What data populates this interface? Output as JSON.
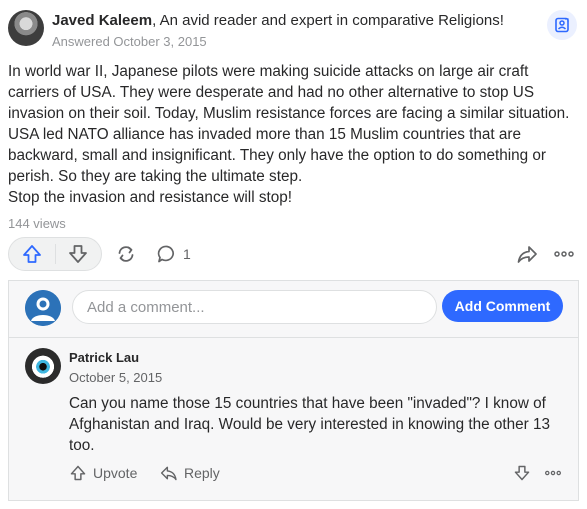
{
  "answer": {
    "author_name": "Javed Kaleem",
    "author_bio": ", An avid reader and expert in comparative Religions!",
    "answered": "Answered October 3, 2015",
    "paragraphs": [
      "In world war II, Japanese pilots were making suicide attacks on large air craft carriers of USA. They were desperate and had no other alternative to stop US invasion on their soil. Today, Muslim resistance forces are facing a similar situation. USA led NATO alliance has invaded more than 15 Muslim countries that are backward, small and insignificant. They only have the option to do something or perish. So they are taking the ultimate step.",
      "Stop the invasion and resistance will stop!"
    ],
    "views": "144 views",
    "comment_count": "1"
  },
  "icons": {
    "bookmark": "bookmark-person-icon",
    "upvote": "upvote-arrow-icon",
    "downvote": "downvote-arrow-icon",
    "share_reload": "reshare-icon",
    "comment": "comment-bubble-icon",
    "share": "share-arrow-icon",
    "more": "more-options-icon"
  },
  "comment_composer": {
    "placeholder": "Add a comment...",
    "button_label": "Add Comment"
  },
  "comment": {
    "author": "Patrick Lau",
    "date": "October 5, 2015",
    "text": "Can you name those 15 countries that have been \"invaded\"? I know of Afghanistan and Iraq. Would be very interested in knowing the other 13 too.",
    "upvote_label": "Upvote",
    "reply_label": "Reply"
  },
  "colors": {
    "accent": "#2e69ff",
    "muted_text": "#939598",
    "panel_bg": "#f7f7f8"
  }
}
